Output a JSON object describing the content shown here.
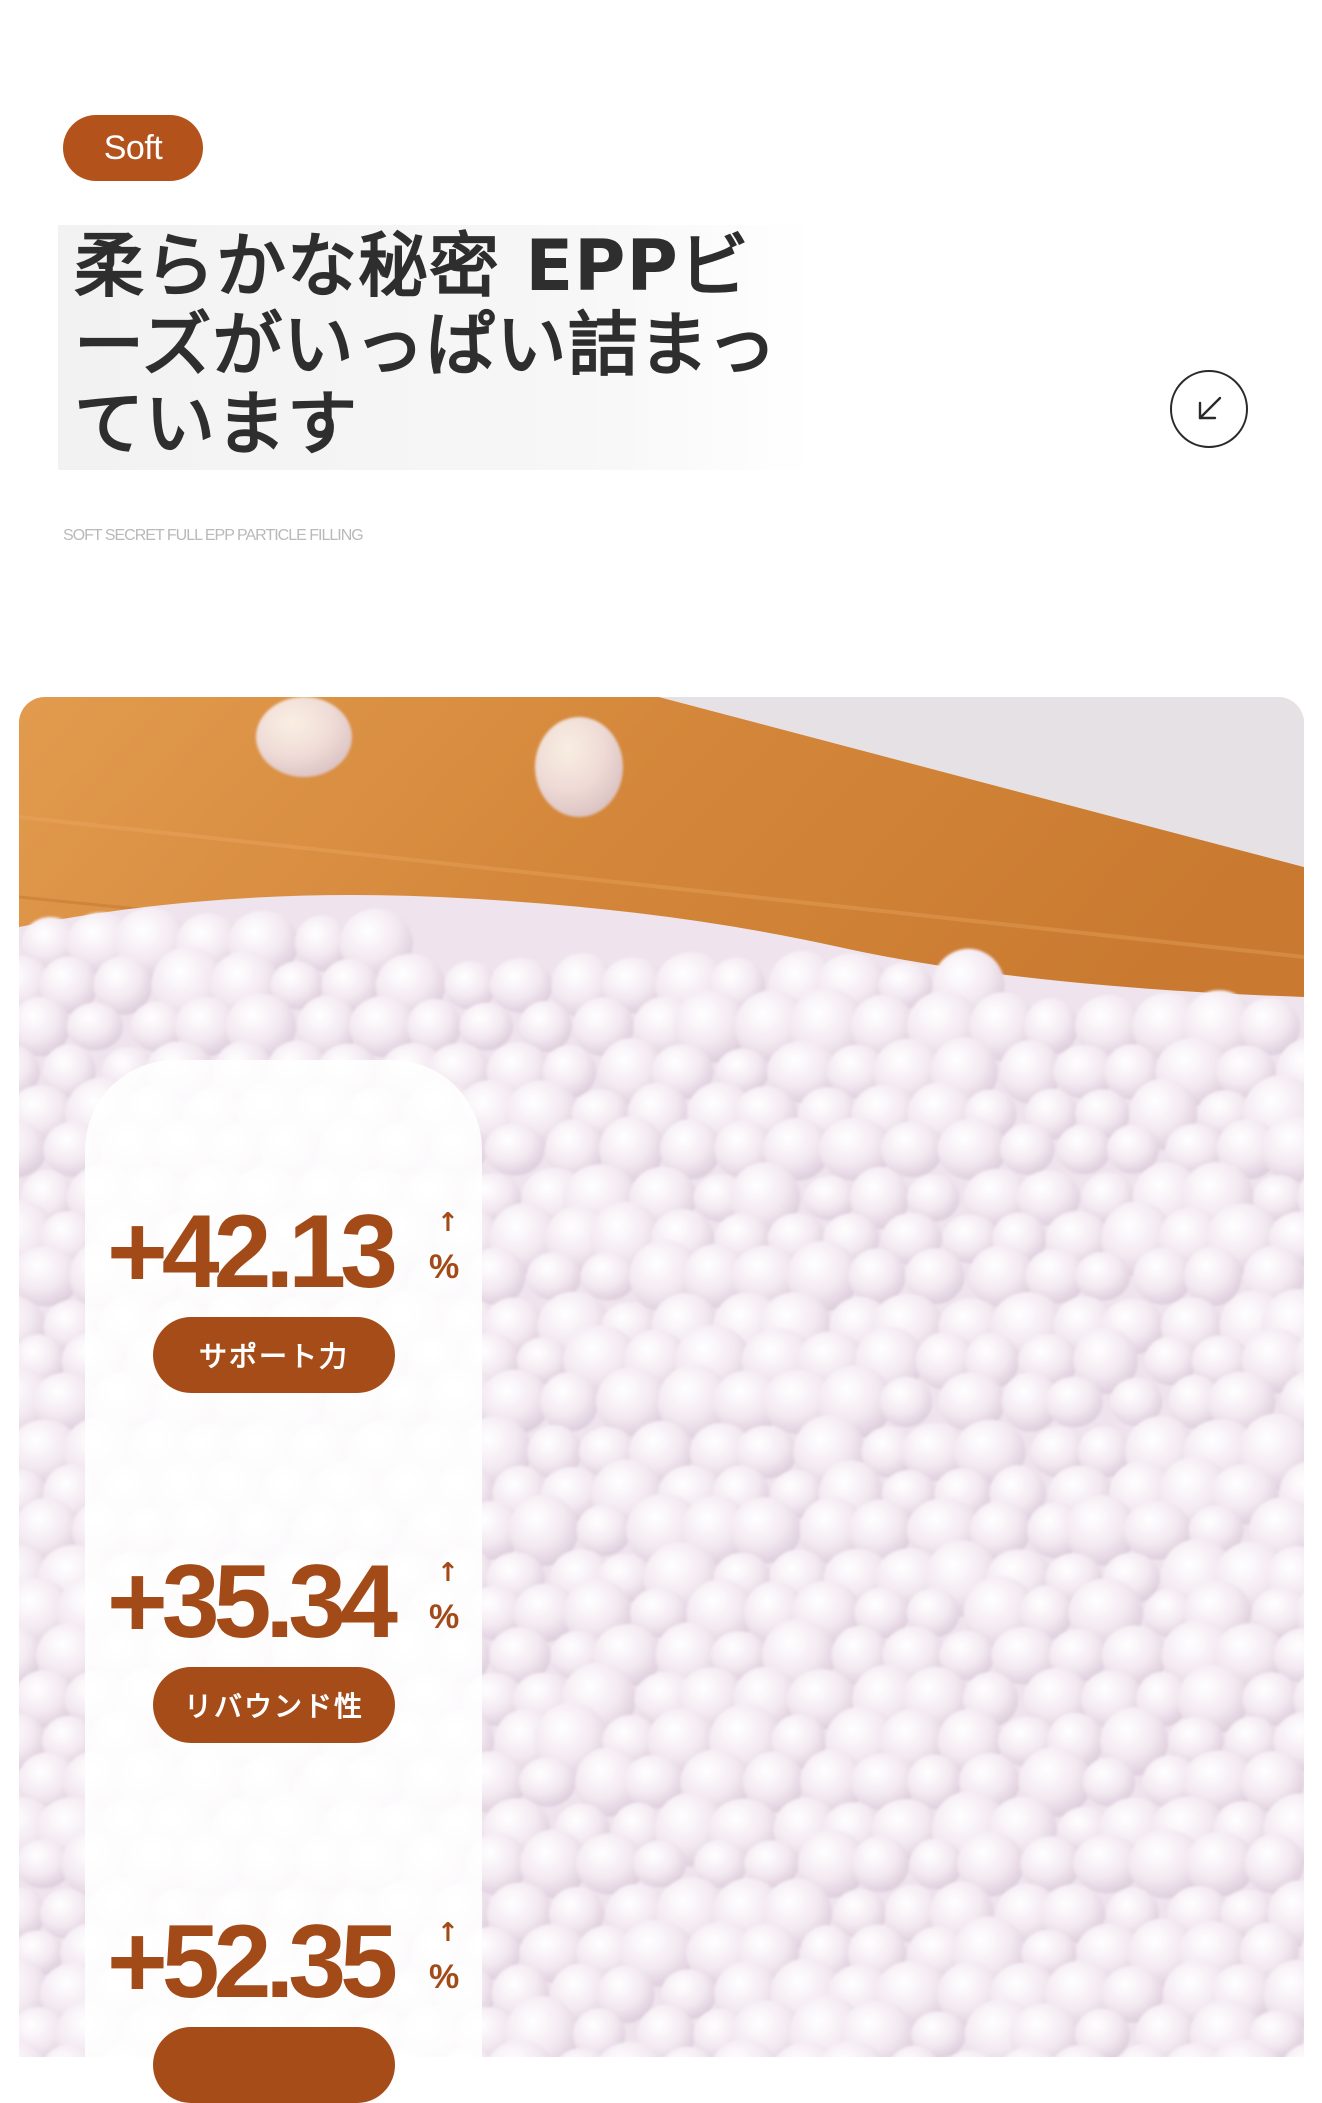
{
  "header": {
    "badge": "Soft",
    "title": "柔らかな秘密 EPPビーズがいっぱい詰まっています",
    "subtitle": "SOFT SECRET FULL EPP PARTICLE FILLING",
    "arrow_icon": "arrow-down-left-icon"
  },
  "stats": [
    {
      "value": "+42.13",
      "unit": "%",
      "arrow": "↑",
      "label": "サポート力"
    },
    {
      "value": "+35.34",
      "unit": "%",
      "arrow": "↑",
      "label": "リバウンド性"
    },
    {
      "value": "+52.35",
      "unit": "%",
      "arrow": "↑",
      "label": ""
    }
  ],
  "colors": {
    "accent": "#b4521c",
    "accent_text": "#a24a18",
    "title": "#2e2e2e",
    "subtitle": "#b9b9b9",
    "beads": "#f2e8f0",
    "wood": "#d68a3c"
  }
}
